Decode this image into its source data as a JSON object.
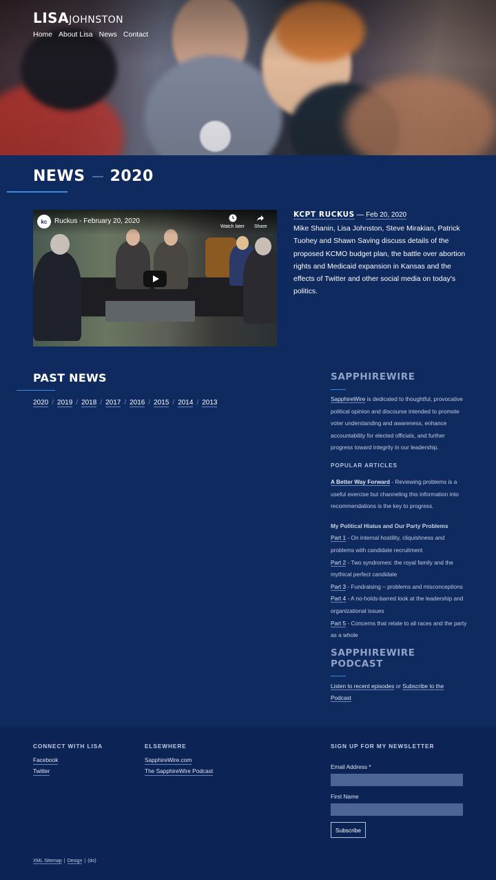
{
  "site": {
    "logo_first": "LISA",
    "logo_last": "JOHNSTON",
    "nav": [
      "Home",
      "About Lisa",
      "News",
      "Contact"
    ]
  },
  "news": {
    "heading": "NEWS",
    "year": "2020",
    "video": {
      "channel_badge": "kc",
      "title": "Ruckus - February 20, 2020",
      "watch_later": "Watch later",
      "share": "Share"
    },
    "item": {
      "source": "KCPT RUCKUS",
      "separator": "—",
      "date": "Feb 20, 2020",
      "description": "Mike Shanin, Lisa Johnston, Steve Mirakian, Patrick Tuohey and Shawn Saving discuss details of the proposed KCMO budget plan, the battle over abortion rights and Medicaid expansion in Kansas and the effects of Twitter and other social media on today's politics."
    }
  },
  "past_news": {
    "heading": "PAST NEWS",
    "years": [
      "2020",
      "2019",
      "2018",
      "2017",
      "2016",
      "2015",
      "2014",
      "2013"
    ]
  },
  "sidebar": {
    "title": "SAPPHIREWIRE",
    "intro_link": "SapphireWire",
    "intro_text": " is dedicated to thoughtful, provocative political opinion and discourse intended to promote voter understanding and awareness, enhance accountability for elected officials, and further progress toward integrity in our leadership.",
    "popular_heading": "POPULAR ARTICLES",
    "article1_link": "A Better Way Forward",
    "article1_text": " - Reviewing problems is a useful exercise but channeling this information into recommendations is the key to progress.",
    "series_title": "My Political Hiatus and Our Party Problems",
    "parts": [
      {
        "label": "Part 1",
        "text": " - On internal hostility, cliquishness and problems with candidate recruitment"
      },
      {
        "label": "Part 2",
        "text": " - Two syndromes: the royal family and the mythical perfect candidate"
      },
      {
        "label": "Part 3",
        "text": " - Fundraising – problems and misconceptions"
      },
      {
        "label": "Part 4",
        "text": " - A no-holds-barred look at the leadership and organizational issues"
      },
      {
        "label": "Part 5",
        "text": " - Concerns that relate to all races and the party as a whole"
      }
    ],
    "podcast_title": "SAPPHIREWIRE PODCAST",
    "podcast_link1": "Listen to recent episodes",
    "podcast_or": " or ",
    "podcast_link2": "Subscribe to the",
    "podcast_link2b": "Podcast"
  },
  "footer": {
    "connect_heading": "CONNECT WITH LISA",
    "connect_links": [
      "Facebook",
      "Twitter"
    ],
    "elsewhere_heading": "ELSEWHERE",
    "elsewhere_links": [
      "SapphireWire.com",
      "The SapphireWire Podcast"
    ],
    "newsletter_heading": "SIGN UP FOR MY NEWSLETTER",
    "email_label": "Email Address",
    "required_mark": "*",
    "first_name_label": "First Name",
    "subscribe_label": "Subscribe",
    "bottom_sitemap": "XML Sitemap",
    "bottom_sep": "|",
    "bottom_design": "Design",
    "bottom_do": "(do)"
  }
}
